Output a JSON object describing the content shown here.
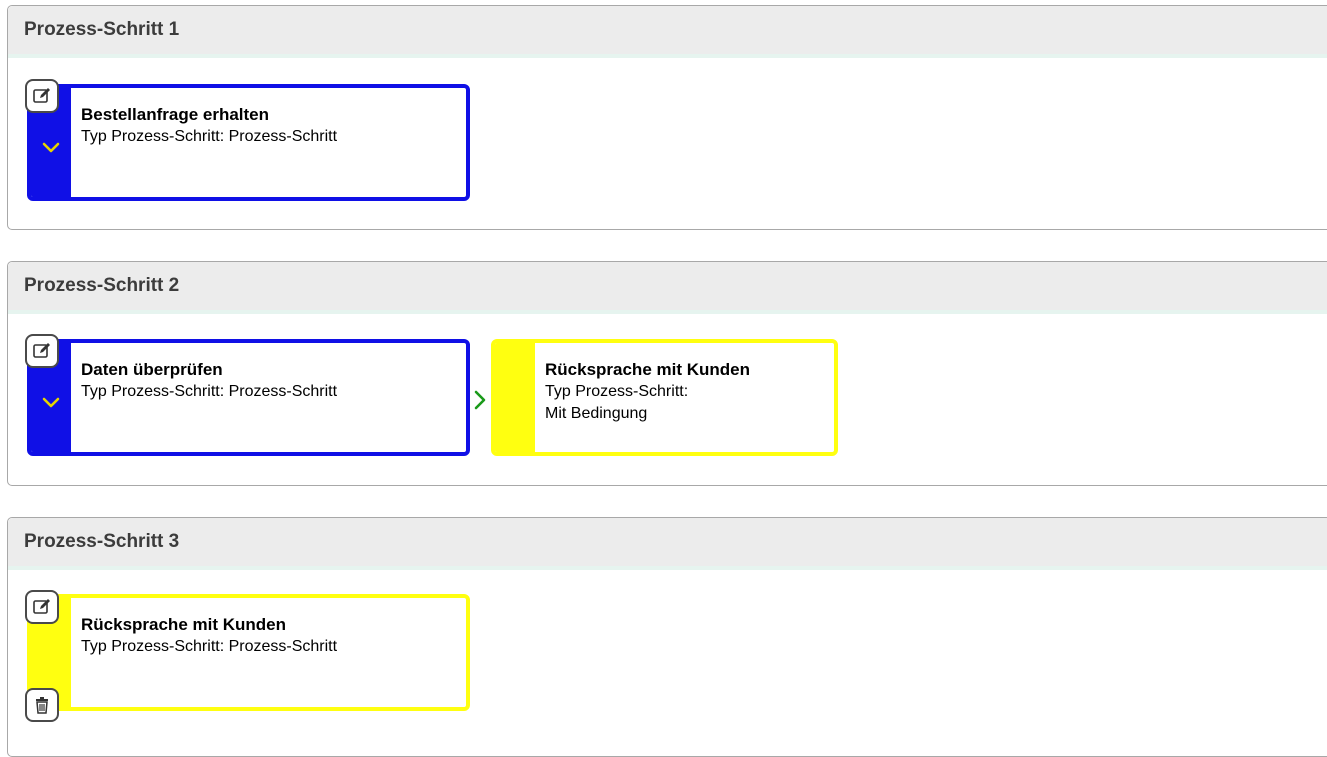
{
  "steps": [
    {
      "header": "Prozess-Schritt 1",
      "cards": [
        {
          "title": "Bestellanfrage erhalten",
          "type_lines": [
            "Typ Prozess-Schritt: Prozess-Schritt"
          ],
          "color": "#1010e6"
        }
      ],
      "actions": [
        "edit-icon",
        "chevron-down-icon"
      ]
    },
    {
      "header": "Prozess-Schritt 2",
      "cards": [
        {
          "title": "Daten überprüfen",
          "type_lines": [
            "Typ Prozess-Schritt: Prozess-Schritt"
          ],
          "color": "#1010e6"
        },
        {
          "title": "Rücksprache mit Kunden",
          "type_lines": [
            "Typ Prozess-Schritt:",
            "Mit Bedingung"
          ],
          "color": "#ffff10"
        }
      ],
      "actions": [
        "edit-icon",
        "chevron-down-icon",
        "chevron-right-icon"
      ]
    },
    {
      "header": "Prozess-Schritt 3",
      "cards": [
        {
          "title": "Rücksprache mit Kunden",
          "type_lines": [
            "Typ Prozess-Schritt: Prozess-Schritt"
          ],
          "color": "#ffff10"
        }
      ],
      "actions": [
        "edit-icon",
        "trash-icon"
      ]
    }
  ],
  "colors": {
    "blue_step": "#1010e6",
    "yellow_step": "#ffff10",
    "chevron_down": "#e6d400",
    "chevron_right": "#1a9a1a",
    "header_bg": "#ececec"
  }
}
